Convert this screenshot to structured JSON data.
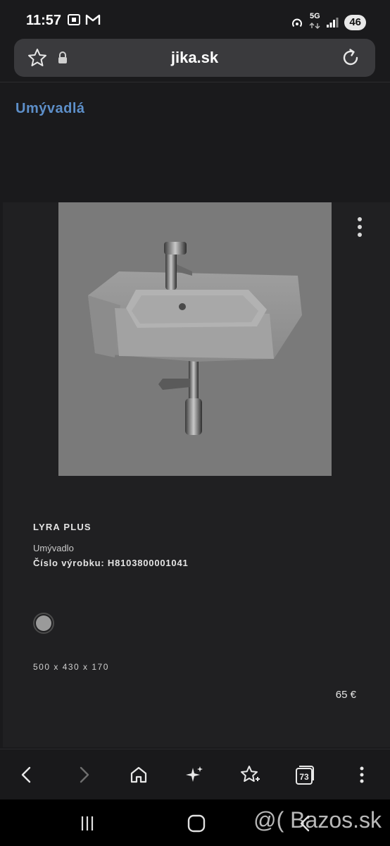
{
  "status_bar": {
    "time": "11:57",
    "network_label": "5G",
    "battery": "46",
    "icons": [
      "screenshot-icon",
      "gmail-icon",
      "hotspot-icon",
      "data-arrows-icon",
      "signal-icon"
    ]
  },
  "url_bar": {
    "url": "jika.sk",
    "icons": [
      "star-icon",
      "lock-icon",
      "reload-icon"
    ]
  },
  "page": {
    "heading": "Umývadlá"
  },
  "product": {
    "name": "LYRA PLUS",
    "type": "Umývadlo",
    "code_label": "Číslo výrobku:",
    "code_value": "H8103800001041",
    "color_swatch": "#9a9a9a",
    "dimensions": "500 x 430 x 170",
    "price": "65 €"
  },
  "toolbar": {
    "items": [
      "back-icon",
      "forward-icon",
      "home-icon",
      "sparkle-icon",
      "bookmark-add-icon",
      "tabs-icon",
      "more-icon"
    ],
    "tabs_count": "73"
  },
  "system_nav": {
    "items": [
      "recent-apps-icon",
      "home-button-icon",
      "back-button-icon"
    ]
  },
  "watermark": {
    "text": "@( Bazos.sk"
  },
  "colors": {
    "background": "#1a1a1c",
    "card": "#202022",
    "heading_accent": "#5d8fc9",
    "image_background": "#7a7a7a"
  }
}
